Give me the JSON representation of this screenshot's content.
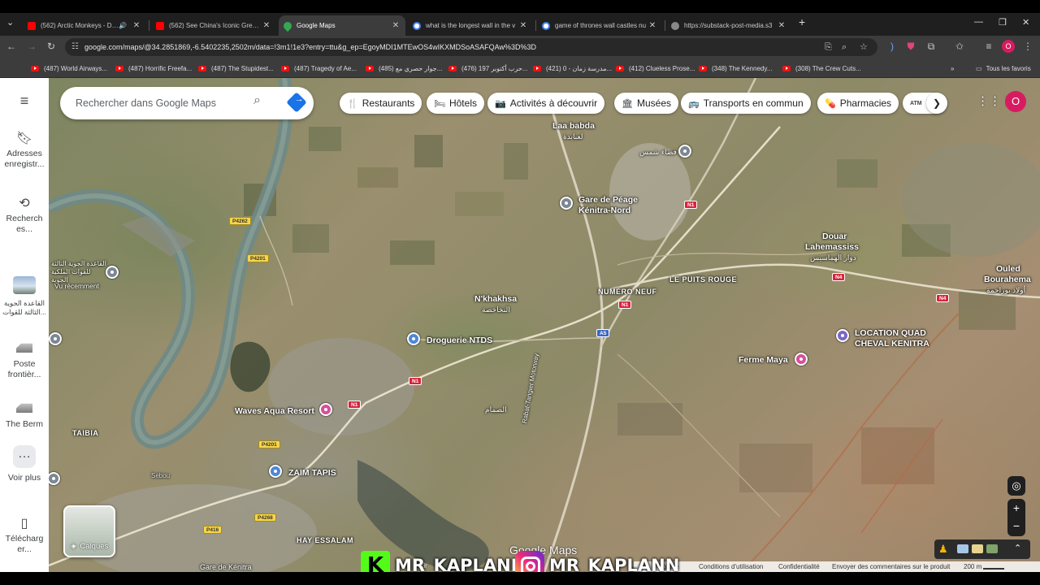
{
  "browser": {
    "tabs": [
      {
        "label": "(562) Arctic Monkeys - Do I",
        "favicon_color": "#ff0000",
        "audio": true
      },
      {
        "label": "(562) See China's Iconic Great W",
        "favicon_color": "#ff0000"
      },
      {
        "label": "Google Maps",
        "favicon_color": "#34a853",
        "active": true
      },
      {
        "label": "what is the longest wall in the v",
        "favicon_color": "#4285f4"
      },
      {
        "label": "game of thrones wall castles nu",
        "favicon_color": "#4285f4"
      },
      {
        "label": "https://substack-post-media.s3",
        "favicon_color": "#888888"
      }
    ],
    "url": "google.com/maps/@34.2851869,-6.5402235,2502m/data=!3m1!1e3?entry=ttu&g_ep=EgoyMDI1MTEwOS4wIKXMDSoASAFQAw%3D%3D",
    "profile_initial": "O",
    "bookmarks": [
      "(487) World Airways...",
      "(487) Horrific Freefa...",
      "(487) The Stupidest...",
      "(487) Tragedy of Ae...",
      "(485) جوار حصري مع...",
      "(476) حرب أكتوبر 197...",
      "(421) مدرسة زمان - 0...",
      "(412) Clueless Prose...",
      "(348) The Kennedy...",
      "(308) The Crew Cuts..."
    ],
    "all_bookmarks": "Tous les favoris"
  },
  "maps": {
    "search_placeholder": "Rechercher dans Google Maps",
    "rail": [
      {
        "label": "Adresses enregistr...",
        "icon": "bookmark-icon"
      },
      {
        "label": "Recherch es...",
        "icon": "history-icon"
      },
      {
        "label": "القاعدة الجوية الثالثة للقوات...",
        "icon": "airbase-thumbnail"
      },
      {
        "label": "Poste frontièr...",
        "icon": "checkpoint-thumbnail"
      },
      {
        "label": "The Berm",
        "icon": "berm-thumbnail"
      },
      {
        "label": "Voir plus",
        "icon": "more-icon"
      },
      {
        "label": "Télécharg er...",
        "icon": "phone-icon"
      }
    ],
    "chips": [
      {
        "label": "Restaurants",
        "icon": "🍴"
      },
      {
        "label": "Hôtels",
        "icon": "🛏"
      },
      {
        "label": "Activités à découvrir",
        "icon": "📷"
      },
      {
        "label": "Musées",
        "icon": "🏛"
      },
      {
        "label": "Transports en commun",
        "icon": "🚌"
      },
      {
        "label": "Pharmacies",
        "icon": "💊"
      },
      {
        "label": "D",
        "icon": "ATM"
      }
    ],
    "user_initial": "O",
    "places": {
      "laa_babda": "Laa babda",
      "laa_babda_ar": "لعبابدة",
      "gare_peage": "Gare de Péage",
      "kenitra_nord": "Kénitra-Nord",
      "fadaa_ar": "فضاء شمس",
      "douar": "Douar",
      "lahemassiss": "Lahemassiss",
      "lahemassiss_ar": "دوار الهماسيس",
      "ouled": "Ouled",
      "bourahema": "Bourahema",
      "bourahema_ar": "أولاد بوراحمة",
      "numero_neuf": "NUMÉRO NEUF",
      "puits_rouge": "LE PUITS ROUGE",
      "nkhakhsa": "N'khakhsa",
      "nkhakhsa_ar": "النخاخصة",
      "droguerie": "Droguerie NTDS",
      "location": "LOCATION QUAD",
      "cheval": "CHEVAL KENITRA",
      "ferme": "Ferme Maya",
      "waves": "Waves Aqua Resort",
      "zaim": "ZAIM TAPIS",
      "taibia": "TAIBIA",
      "hay_essalam": "HAY ESSALAM",
      "gare_kenitra": "Gare de Kénitra",
      "vu_recemment": "Vu récemment",
      "airbase_ar": "القاعدة الجوية الثالثة للقوات الملكية الجوية",
      "mosque_ar": "الصمام",
      "rabat_tangier": "Rabat-Tangier Motorway",
      "sebou": "Sebou"
    },
    "roads": [
      "P4262",
      "P4201",
      "P4201",
      "P4268",
      "P416",
      "N1",
      "N1",
      "N1",
      "N1",
      "N4",
      "N4",
      "A5"
    ],
    "layers_label": "Calques",
    "google_logo": "Google Maps",
    "footer": {
      "airbus": "Air",
      "conditions": "Conditions d'utilisation",
      "confidentialite": "Confidentialité",
      "feedback": "Envoyer des commentaires sur le produit",
      "scale": "200 m",
      "logique": "gique"
    }
  },
  "watermark": {
    "kick": "MR_KAPLANN",
    "insta": "MR_KAPLANN"
  }
}
